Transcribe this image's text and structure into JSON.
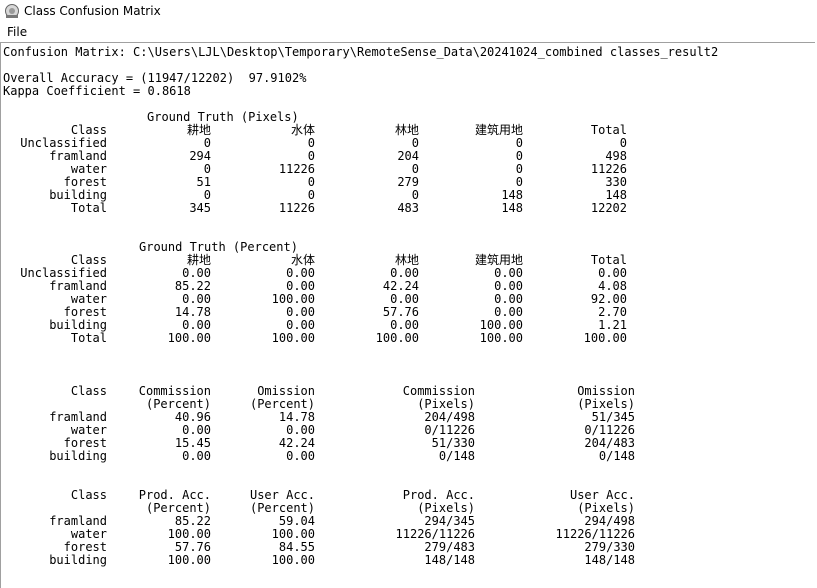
{
  "window": {
    "title": "Class Confusion Matrix"
  },
  "menu": {
    "file": "File"
  },
  "report": {
    "header": "Confusion Matrix: C:\\Users\\LJL\\Desktop\\Temporary\\RemoteSense_Data\\20241024_combined classes_result2",
    "overall_accuracy": "Overall Accuracy = (11947/12202)  97.9102%",
    "kappa": "Kappa Coefficient = 0.8618",
    "pixels": {
      "title": "Ground Truth (Pixels)",
      "headers": [
        "Class",
        "耕地",
        "水体",
        "林地",
        "建筑用地",
        "Total"
      ],
      "rows": [
        [
          "Unclassified",
          "0",
          "0",
          "0",
          "0",
          "0"
        ],
        [
          "framland",
          "294",
          "0",
          "204",
          "0",
          "498"
        ],
        [
          "water",
          "0",
          "11226",
          "0",
          "0",
          "11226"
        ],
        [
          "forest",
          "51",
          "0",
          "279",
          "0",
          "330"
        ],
        [
          "building",
          "0",
          "0",
          "0",
          "148",
          "148"
        ],
        [
          "Total",
          "345",
          "11226",
          "483",
          "148",
          "12202"
        ]
      ]
    },
    "percent": {
      "title": "Ground Truth (Percent)",
      "headers": [
        "Class",
        "耕地",
        "水体",
        "林地",
        "建筑用地",
        "Total"
      ],
      "rows": [
        [
          "Unclassified",
          "0.00",
          "0.00",
          "0.00",
          "0.00",
          "0.00"
        ],
        [
          "framland",
          "85.22",
          "0.00",
          "42.24",
          "0.00",
          "4.08"
        ],
        [
          "water",
          "0.00",
          "100.00",
          "0.00",
          "0.00",
          "92.00"
        ],
        [
          "forest",
          "14.78",
          "0.00",
          "57.76",
          "0.00",
          "2.70"
        ],
        [
          "building",
          "0.00",
          "0.00",
          "0.00",
          "100.00",
          "1.21"
        ],
        [
          "Total",
          "100.00",
          "100.00",
          "100.00",
          "100.00",
          "100.00"
        ]
      ]
    },
    "commission": {
      "headers1": [
        "Class",
        "Commission",
        "Omission",
        "Commission",
        "Omission"
      ],
      "headers2": [
        "",
        "(Percent)",
        "(Percent)",
        "(Pixels)",
        "(Pixels)"
      ],
      "rows": [
        [
          "framland",
          "40.96",
          "14.78",
          "204/498",
          "51/345"
        ],
        [
          "water",
          "0.00",
          "0.00",
          "0/11226",
          "0/11226"
        ],
        [
          "forest",
          "15.45",
          "42.24",
          "51/330",
          "204/483"
        ],
        [
          "building",
          "0.00",
          "0.00",
          "0/148",
          "0/148"
        ]
      ]
    },
    "accuracy": {
      "headers1": [
        "Class",
        "Prod. Acc.",
        "User Acc.",
        "Prod. Acc.",
        "User Acc."
      ],
      "headers2": [
        "",
        "(Percent)",
        "(Percent)",
        "(Pixels)",
        "(Pixels)"
      ],
      "rows": [
        [
          "framland",
          "85.22",
          "59.04",
          "294/345",
          "294/498"
        ],
        [
          "water",
          "100.00",
          "100.00",
          "11226/11226",
          "11226/11226"
        ],
        [
          "forest",
          "57.76",
          "84.55",
          "279/483",
          "279/330"
        ],
        [
          "building",
          "100.00",
          "100.00",
          "148/148",
          "148/148"
        ]
      ]
    }
  }
}
